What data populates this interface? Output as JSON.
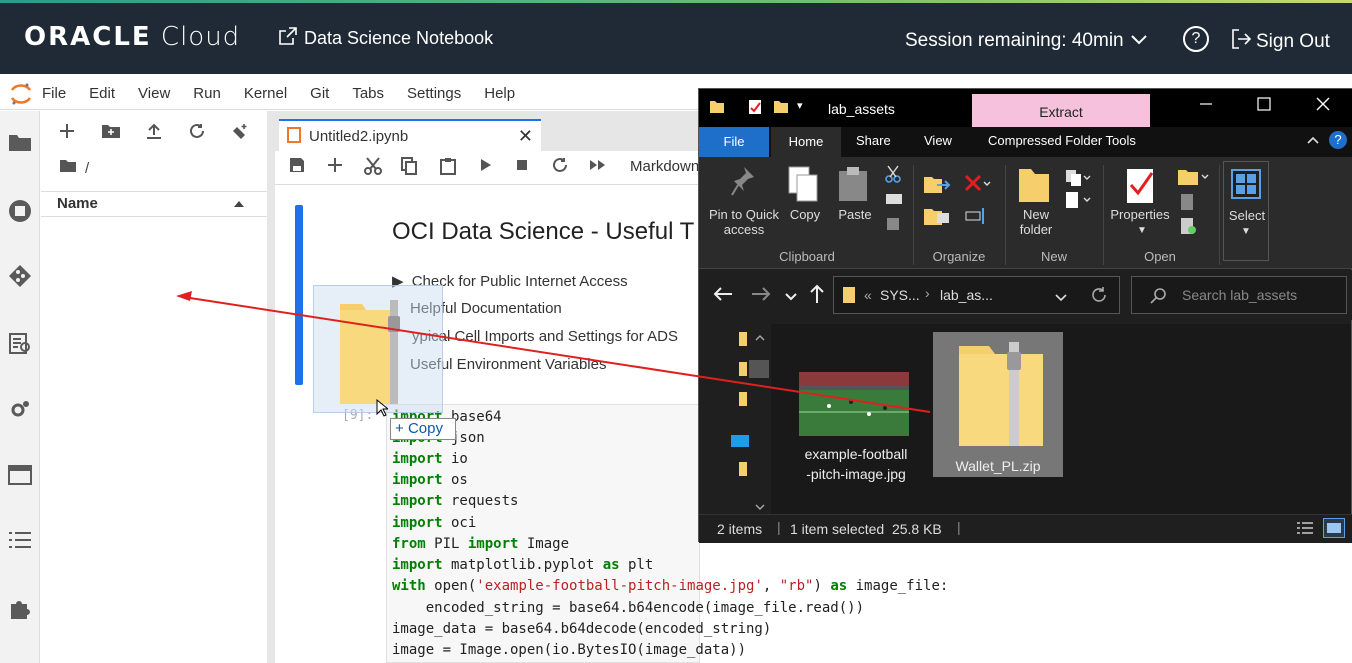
{
  "header": {
    "brand_strong": "ORACLE",
    "brand_light": "Cloud",
    "app_title": "Data Science Notebook",
    "session": "Session remaining: 40min",
    "help": "?",
    "sign_out": "Sign Out"
  },
  "menu": [
    "File",
    "Edit",
    "View",
    "Run",
    "Kernel",
    "Git",
    "Tabs",
    "Settings",
    "Help"
  ],
  "file_panel": {
    "path": "/",
    "column_name": "Name"
  },
  "notebook": {
    "tab_label": "Untitled2.ipynb",
    "cell_type": "Markdown",
    "title": "OCI Data Science - Useful T",
    "toc": [
      "Check for Public Internet Access",
      "Helpful Documentation",
      "ypical Cell Imports and Settings for ADS",
      "Useful Environment Variables"
    ],
    "prompt": "[9]:",
    "code_lines": [
      "import base64",
      "import json",
      "import io",
      "import os",
      "import requests",
      "import oci",
      "from PIL import Image",
      "import matplotlib.pyplot as plt",
      "with open('example-football-pitch-image.jpg', \"rb\") as image_file:",
      "    encoded_string = base64.b64encode(image_file.read())",
      "image_data = base64.b64decode(encoded_string)",
      "image = Image.open(io.BytesIO(image_data))"
    ]
  },
  "drag": {
    "tooltip": "Copy",
    "tooltip_prefix": "+"
  },
  "explorer": {
    "title": "lab_assets",
    "context_tab": "Extract",
    "tabs": [
      "File",
      "Home",
      "Share",
      "View",
      "Compressed Folder Tools"
    ],
    "ribbon_buttons": {
      "pin": "Pin to Quick access",
      "copy": "Copy",
      "paste": "Paste",
      "new_folder": "New folder",
      "properties": "Properties",
      "select": "Select"
    },
    "groups": [
      "Clipboard",
      "Organize",
      "New",
      "Open"
    ],
    "address": {
      "prefix": "«",
      "part1": "SYS...",
      "part2": "lab_as..."
    },
    "search_placeholder": "Search lab_assets",
    "files": [
      {
        "name": "example-football-pitch-image.jpg",
        "line1": "example-football",
        "line2": "-pitch-image.jpg"
      },
      {
        "name": "Wallet_PL.zip"
      }
    ],
    "status": {
      "count": "2 items",
      "selection": "1 item selected  25.8 KB"
    }
  },
  "colors": {
    "header_bg": "#1f2a36",
    "accent_blue": "#1a73e8",
    "extract_pink": "#f5c1dc",
    "arrow_red": "#e02020"
  }
}
